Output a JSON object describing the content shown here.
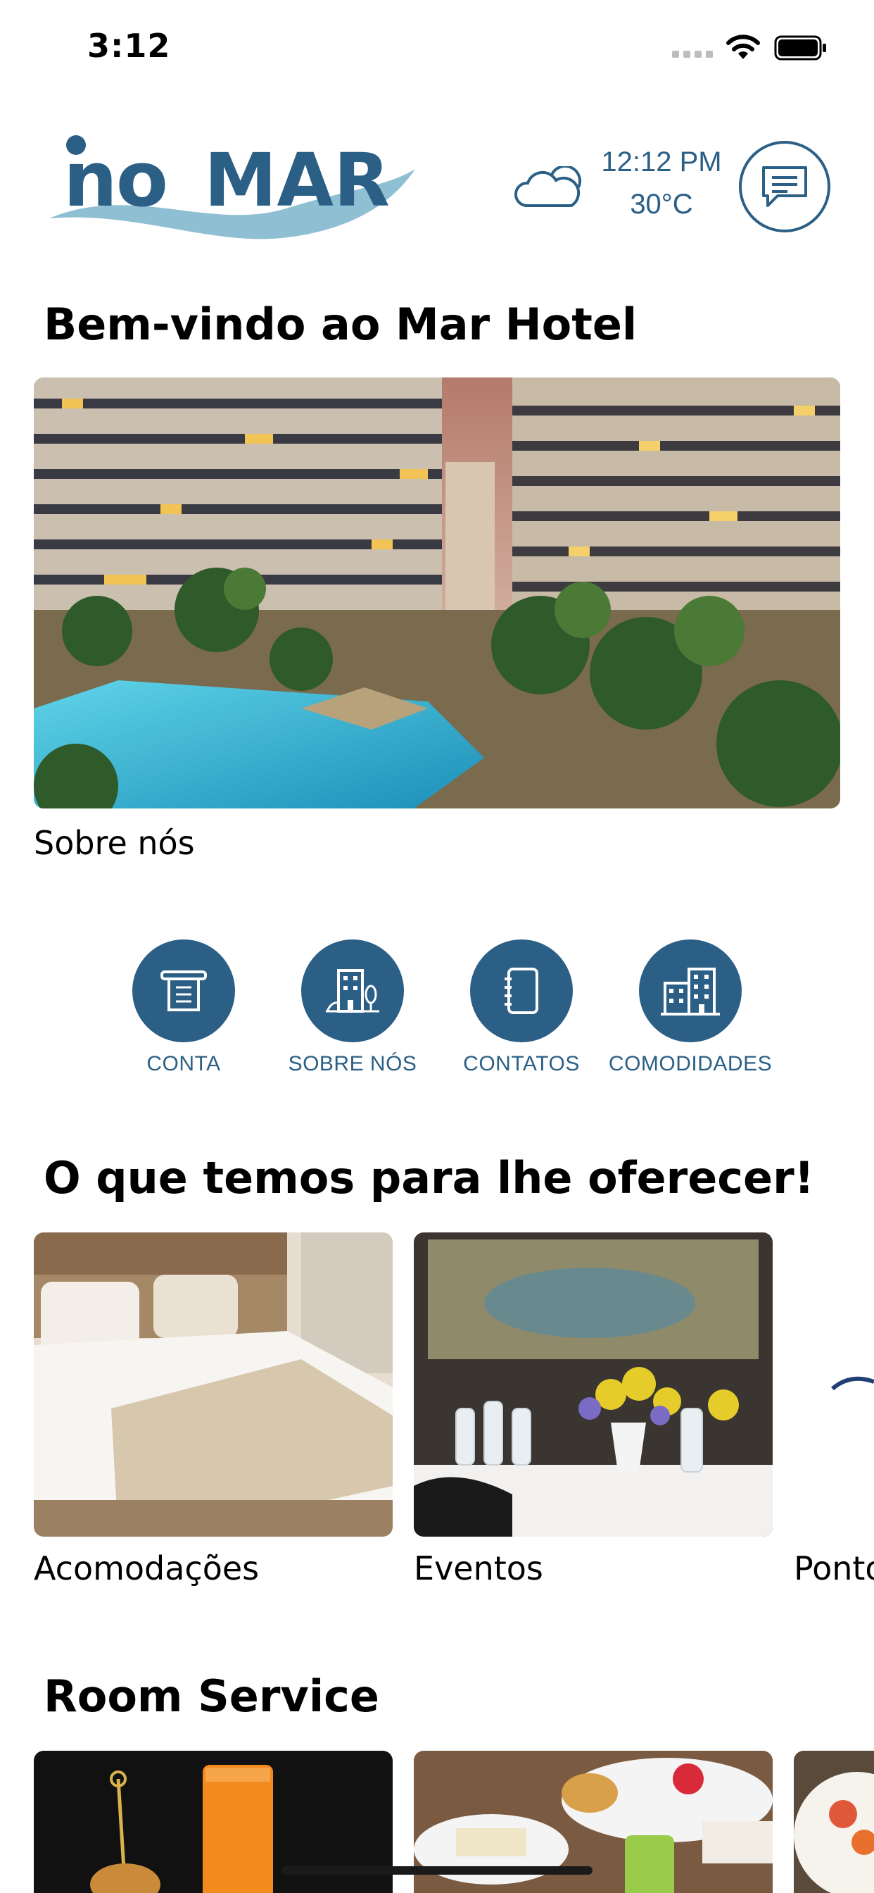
{
  "status_bar": {
    "time": "3:12"
  },
  "header": {
    "logo_text": "NO MAR",
    "weather": {
      "time": "12:12 PM",
      "temperature": "30°C",
      "icon": "cloud-icon"
    },
    "chat_icon": "chat-icon"
  },
  "welcome": {
    "title": "Bem-vindo ao Mar Hotel",
    "hero_caption": "Sobre nós"
  },
  "quick_actions": [
    {
      "label": "CONTA",
      "icon": "receipt-icon"
    },
    {
      "label": "SOBRE NÓS",
      "icon": "hotel-icon"
    },
    {
      "label": "CONTATOS",
      "icon": "notebook-icon"
    },
    {
      "label": "COMODIDADES",
      "icon": "buildings-icon"
    }
  ],
  "offers": {
    "title": "O que temos para lhe oferecer!",
    "items": [
      {
        "label": "Acomodações"
      },
      {
        "label": "Eventos"
      },
      {
        "label": "Ponto"
      }
    ]
  },
  "room_service": {
    "title": "Room Service"
  },
  "colors": {
    "brand": "#2b5f86",
    "wave": "#8fbfd3"
  }
}
